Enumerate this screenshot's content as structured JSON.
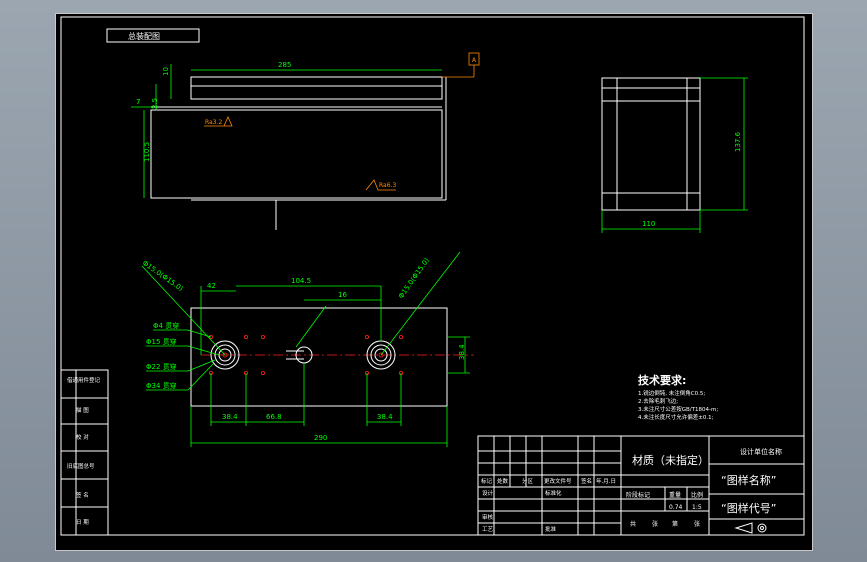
{
  "title_tag": "总装配图",
  "dims": {
    "top_len": "285",
    "top_10": "10",
    "top_7": "7",
    "top_side": "2.5",
    "top_height": "110.5",
    "side_height": "137.6",
    "side_width": "110",
    "bot_42": "42",
    "bot_span": "104.5",
    "bot_16": "16",
    "bot_38_4a": "38.4",
    "bot_66_8": "66.8",
    "bot_38_4b": "38.4",
    "bot_total": "290",
    "bot_right": "38.4",
    "leader_left": "Φ15.0(Φ15.0)",
    "leader_right": "Φ15.0(Φ15.0)"
  },
  "roughness": {
    "r1": "Ra3.2",
    "r2": "Ra6.3"
  },
  "datum": "A",
  "hole_labels": [
    "Φ4 贯穿",
    "Φ15 贯穿",
    "Φ22 贯穿",
    "Φ34 贯穿"
  ],
  "tech": {
    "heading": "技术要求:",
    "lines": [
      "1.锐边倒钝, 未注倒角C0.5;",
      "2.去除毛刺飞边;",
      "3.未注尺寸公差按GB/T1804-m;",
      "4.未注长度尺寸允许偏差±0.1;"
    ]
  },
  "left_strip": [
    "借通用件登记",
    "描 图",
    "校 对",
    "旧底图总号",
    "签 名",
    "日 期"
  ],
  "title_block": {
    "material": "材质（未指定）",
    "company": "设计单位名称",
    "drawing_name": "“图样名称”",
    "drawing_code": "“图样代号”",
    "head_cols": [
      "标记",
      "处数",
      "分区",
      "更改文件号",
      "签名",
      "年.月.日"
    ],
    "row_design": "设计",
    "row_std": "标准化",
    "row_review": "审核",
    "row_process": "工艺",
    "row_approve": "批准",
    "stage_headers": [
      "阶段标记",
      "重量",
      "比例"
    ],
    "weight": "0.74",
    "scale": "1:5",
    "sheets": [
      "共",
      "张",
      "第",
      "张"
    ]
  },
  "colors": {
    "geometry": "#ffffff",
    "dimension": "#00ff00",
    "centerline": "#ff2020",
    "annotation": "#ff8c00"
  }
}
